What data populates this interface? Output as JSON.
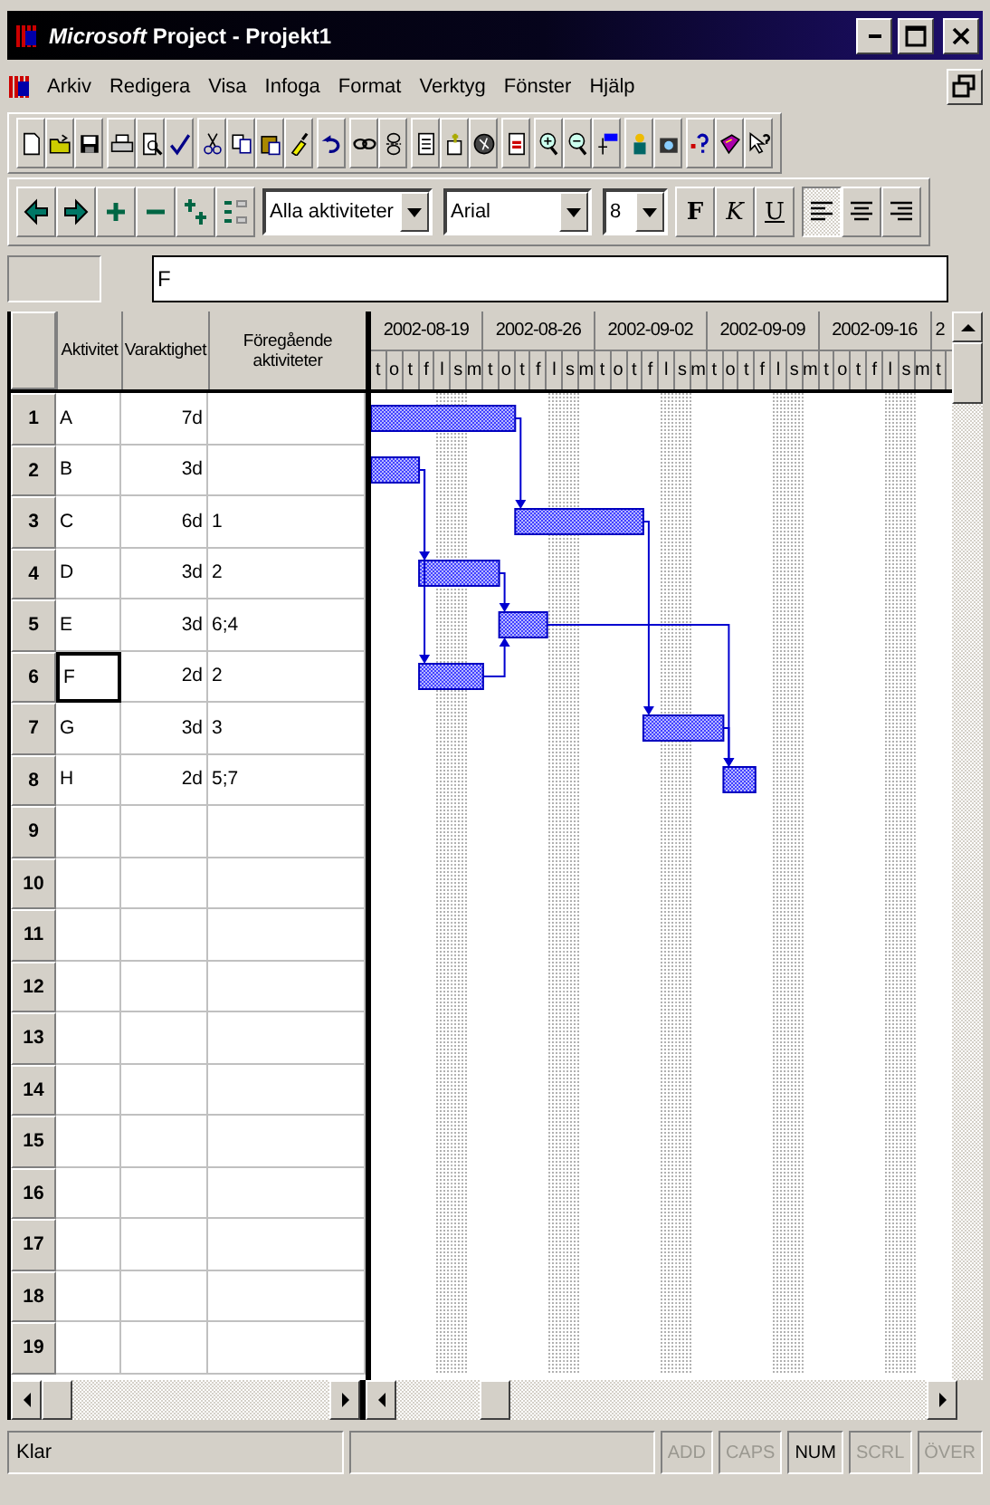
{
  "window": {
    "title": "*Microsoft* Project - Projekt1"
  },
  "menu": [
    "Arkiv",
    "Redigera",
    "Visa",
    "Infoga",
    "Format",
    "Verktyg",
    "Fönster",
    "Hjälp"
  ],
  "format_toolbar": {
    "filter": "Alla aktiviteter",
    "font": "Arial",
    "size": "8",
    "styles": [
      {
        "kind": "bold",
        "label": "F",
        "selected": false
      },
      {
        "kind": "italic",
        "label": "K",
        "selected": false
      },
      {
        "kind": "underline",
        "label": "U",
        "selected": false
      }
    ],
    "alignment": [
      {
        "kind": "left",
        "selected": true
      },
      {
        "kind": "center",
        "selected": false
      },
      {
        "kind": "right",
        "selected": false
      }
    ]
  },
  "entry_bar": {
    "value": "F"
  },
  "table": {
    "columns": [
      "Aktivitet",
      "Varaktighet",
      "Föregående aktiviteter"
    ],
    "rows": [
      {
        "number": "1",
        "name": "A",
        "duration": "7d",
        "predecessors": "",
        "selected": false
      },
      {
        "number": "2",
        "name": "B",
        "duration": "3d",
        "predecessors": "",
        "selected": false
      },
      {
        "number": "3",
        "name": "C",
        "duration": "6d",
        "predecessors": "1",
        "selected": false
      },
      {
        "number": "4",
        "name": "D",
        "duration": "3d",
        "predecessors": "2",
        "selected": false
      },
      {
        "number": "5",
        "name": "E",
        "duration": "3d",
        "predecessors": "6;4",
        "selected": false
      },
      {
        "number": "6",
        "name": "F",
        "duration": "2d",
        "predecessors": "2",
        "selected": true
      },
      {
        "number": "7",
        "name": "G",
        "duration": "3d",
        "predecessors": "3",
        "selected": false
      },
      {
        "number": "8",
        "name": "H",
        "duration": "2d",
        "predecessors": "5;7",
        "selected": false
      },
      {
        "number": "9",
        "selected": false
      },
      {
        "number": "10",
        "selected": false
      },
      {
        "number": "11",
        "selected": false
      },
      {
        "number": "12",
        "selected": false
      },
      {
        "number": "13",
        "selected": false
      },
      {
        "number": "14",
        "selected": false
      },
      {
        "number": "15",
        "selected": false
      },
      {
        "number": "16",
        "selected": false
      },
      {
        "number": "17",
        "selected": false
      },
      {
        "number": "18",
        "selected": false
      },
      {
        "number": "19",
        "selected": false
      }
    ]
  },
  "gantt": {
    "weeks": [
      "2002-08-19",
      "2002-08-26",
      "2002-09-02",
      "2002-09-09",
      "2002-09-16",
      "2"
    ],
    "days": [
      "t",
      "o",
      "t",
      "f",
      "l",
      "s",
      "m",
      "t",
      "o",
      "t",
      "f",
      "l",
      "s",
      "m",
      "t",
      "o",
      "t",
      "f",
      "l",
      "s",
      "m",
      "t",
      "o",
      "t",
      "f",
      "l",
      "s",
      "m",
      "t",
      "o",
      "t",
      "f",
      "l",
      "s",
      "m",
      "t"
    ]
  },
  "status_bar": {
    "message": "Klar",
    "indicators": [
      {
        "label": "ADD",
        "active": false
      },
      {
        "label": "CAPS",
        "active": false
      },
      {
        "label": "NUM",
        "active": true
      },
      {
        "label": "SCRL",
        "active": false
      },
      {
        "label": "ÖVER",
        "active": false
      }
    ]
  }
}
